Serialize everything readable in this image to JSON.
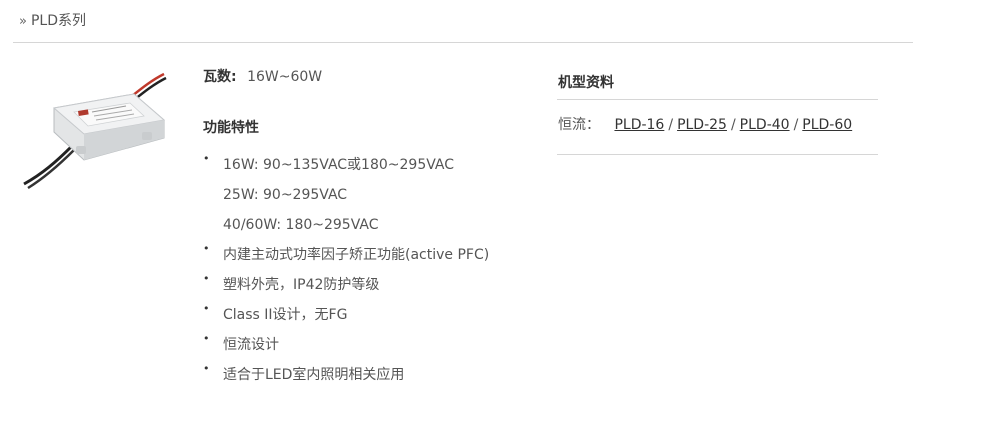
{
  "header": {
    "chevron_icon": "double-chevron-right-icon",
    "title": "PLD系列"
  },
  "product": {
    "power_label": "瓦数:",
    "power_value": "16W~60W",
    "features_title": "功能特性",
    "features": [
      "16W: 90~135VAC或180~295VAC",
      "25W: 90~295VAC",
      "40/60W: 180~295VAC",
      "内建主动式功率因子矫正功能(active PFC)",
      "塑料外壳，IP42防护等级",
      "Class II设计，无FG",
      "恒流设计",
      "适合于LED室内照明相关应用"
    ]
  },
  "models": {
    "title": "机型资料",
    "row_label": "恒流：",
    "links": [
      "PLD-16",
      "PLD-25",
      "PLD-40",
      "PLD-60"
    ],
    "separator": "/"
  }
}
